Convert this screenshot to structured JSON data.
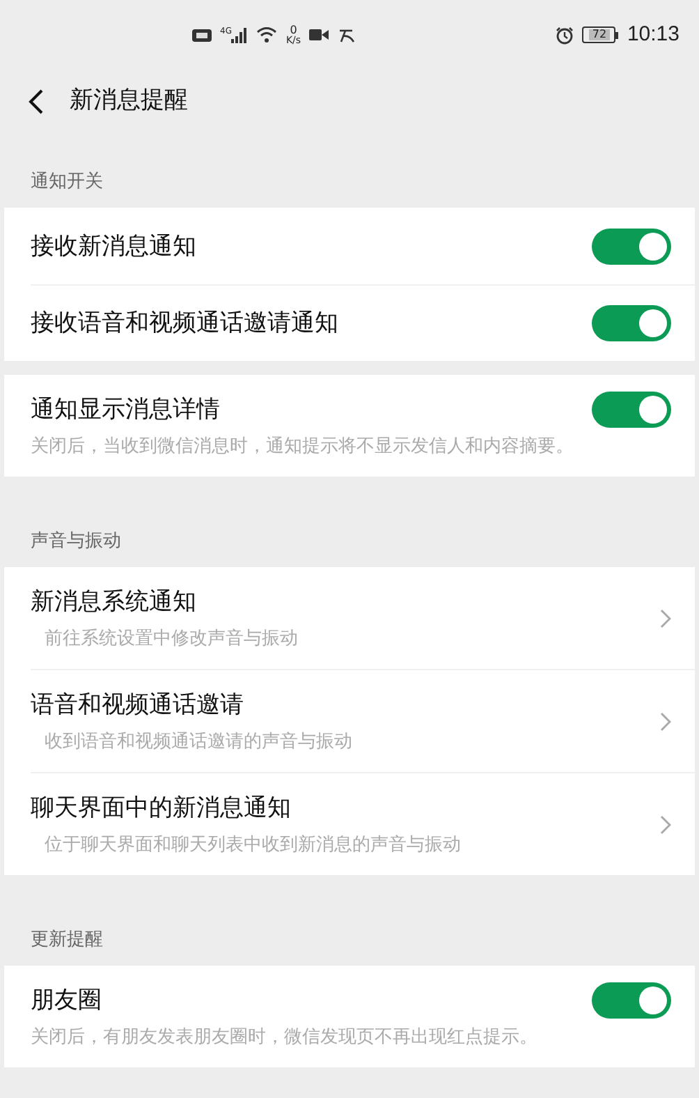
{
  "status_bar": {
    "network_type": "4G",
    "speed_value": "0",
    "speed_unit": "K/s",
    "battery": "72",
    "time": "10:13"
  },
  "title": "新消息提醒",
  "sections": [
    {
      "header": "通知开关",
      "items": [
        {
          "kind": "toggle",
          "label": "接收新消息通知",
          "on": true
        },
        {
          "kind": "toggle",
          "label": "接收语音和视频通话邀请通知",
          "on": true
        }
      ]
    },
    {
      "items": [
        {
          "kind": "toggle",
          "label": "通知显示消息详情",
          "on": true,
          "description": "关闭后，当收到微信消息时，通知提示将不显示发信人和内容摘要。"
        }
      ]
    },
    {
      "header": "声音与振动",
      "items": [
        {
          "kind": "nav",
          "label": "新消息系统通知",
          "description": "前往系统设置中修改声音与振动"
        },
        {
          "kind": "nav",
          "label": "语音和视频通话邀请",
          "description": "收到语音和视频通话邀请的声音与振动"
        },
        {
          "kind": "nav",
          "label": "聊天界面中的新消息通知",
          "description": "位于聊天界面和聊天列表中收到新消息的声音与振动"
        }
      ]
    },
    {
      "header": "更新提醒",
      "items": [
        {
          "kind": "toggle",
          "label": "朋友圈",
          "on": true,
          "description": "关闭后，有朋友发表朋友圈时，微信发现页不再出现红点提示。"
        }
      ]
    }
  ]
}
